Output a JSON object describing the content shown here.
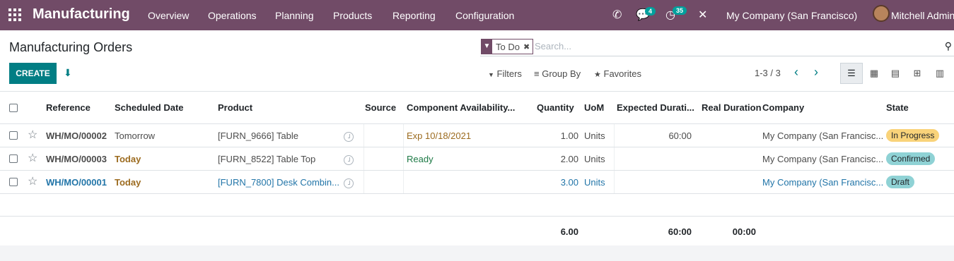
{
  "navbar": {
    "app_name": "Manufacturing",
    "menu": [
      "Overview",
      "Operations",
      "Planning",
      "Products",
      "Reporting",
      "Configuration"
    ],
    "messages_count": "4",
    "activities_count": "35",
    "company": "My Company (San Francisco)",
    "user": "Mitchell Admin"
  },
  "control": {
    "title": "Manufacturing Orders",
    "facet": "To Do",
    "search_placeholder": "Search...",
    "create_label": "CREATE",
    "filters_label": "Filters",
    "groupby_label": "Group By",
    "favorites_label": "Favorites",
    "pager": "1-3 / 3"
  },
  "table": {
    "headers": {
      "reference": "Reference",
      "scheduled_date": "Scheduled Date",
      "product": "Product",
      "source": "Source",
      "component_availability": "Component Availability...",
      "quantity": "Quantity",
      "uom": "UoM",
      "expected_duration": "Expected Durati...",
      "real_duration": "Real Duration",
      "company": "Company",
      "state": "State"
    },
    "rows": [
      {
        "reference": "WH/MO/00002",
        "date": "Tomorrow",
        "product": "[FURN_9666] Table",
        "availability": "Exp 10/18/2021",
        "quantity": "1.00",
        "uom": "Units",
        "expected": "60:00",
        "real": "",
        "company": "My Company (San Francisc...",
        "state": "In Progress"
      },
      {
        "reference": "WH/MO/00003",
        "date": "Today",
        "product": "[FURN_8522] Table Top",
        "availability": "Ready",
        "quantity": "2.00",
        "uom": "Units",
        "expected": "",
        "real": "",
        "company": "My Company (San Francisc...",
        "state": "Confirmed"
      },
      {
        "reference": "WH/MO/00001",
        "date": "Today",
        "product": "[FURN_7800] Desk Combin...",
        "availability": "",
        "quantity": "3.00",
        "uom": "Units",
        "expected": "",
        "real": "",
        "company": "My Company (San Francisc...",
        "state": "Draft"
      }
    ],
    "totals": {
      "quantity": "6.00",
      "expected": "60:00",
      "real": "00:00"
    }
  },
  "colors": {
    "navbar": "#714b67",
    "primary": "#017e84",
    "in_progress": "#f9d37a",
    "confirmed": "#8fd2d5",
    "draft": "#8fd2d5"
  }
}
